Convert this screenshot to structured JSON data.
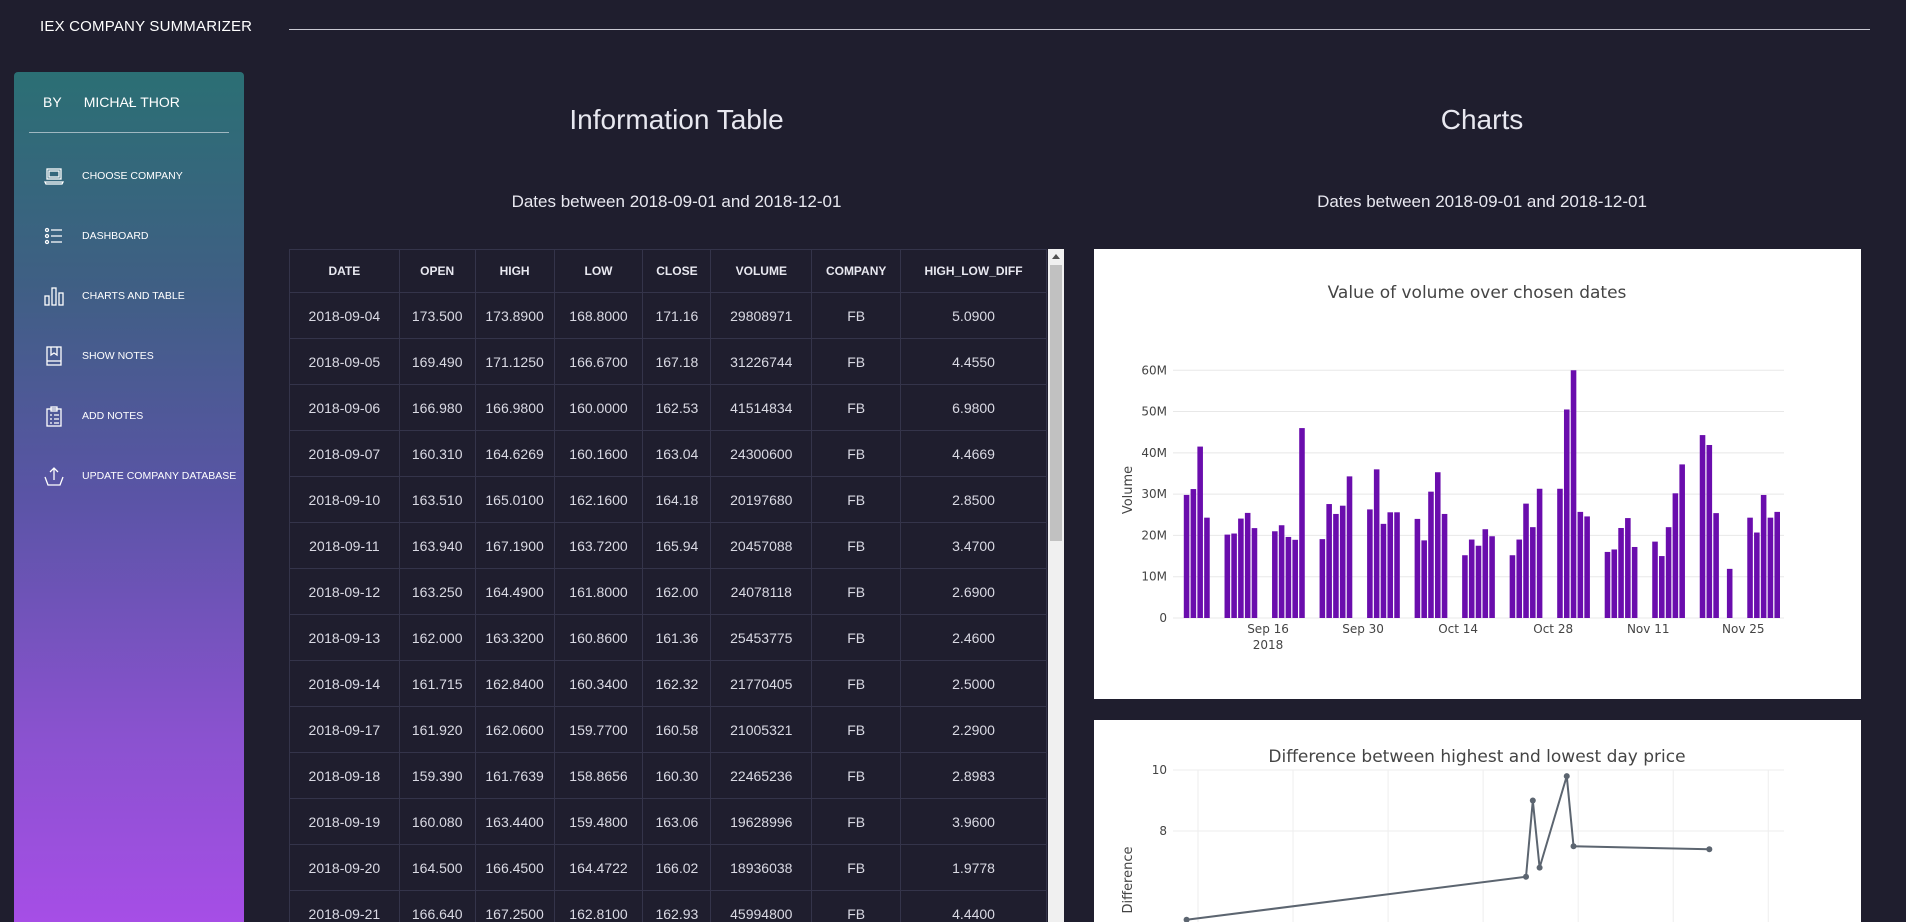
{
  "app": {
    "title": "IEX COMPANY SUMMARIZER"
  },
  "sidebar": {
    "by_label": "BY",
    "author": "MICHAŁ THOR",
    "items": [
      {
        "label": "CHOOSE COMPANY",
        "icon": "laptop-icon"
      },
      {
        "label": "DASHBOARD",
        "icon": "list-icon"
      },
      {
        "label": "CHARTS AND TABLE",
        "icon": "bar-chart-icon"
      },
      {
        "label": "SHOW NOTES",
        "icon": "bookmark-icon"
      },
      {
        "label": "ADD NOTES",
        "icon": "clipboard-icon"
      },
      {
        "label": "UPDATE COMPANY DATABASE",
        "icon": "upload-icon"
      }
    ],
    "colors": {
      "top": "#2b6f74",
      "bottom": "#a64ee6"
    }
  },
  "table_section": {
    "title": "Information Table",
    "subtitle": "Dates between 2018-09-01 and 2018-12-01",
    "columns": [
      "DATE",
      "OPEN",
      "HIGH",
      "LOW",
      "CLOSE",
      "VOLUME",
      "COMPANY",
      "HIGH_LOW_DIFF"
    ],
    "rows": [
      [
        "2018-09-04",
        "173.500",
        "173.8900",
        "168.8000",
        "171.16",
        "29808971",
        "FB",
        "5.0900"
      ],
      [
        "2018-09-05",
        "169.490",
        "171.1250",
        "166.6700",
        "167.18",
        "31226744",
        "FB",
        "4.4550"
      ],
      [
        "2018-09-06",
        "166.980",
        "166.9800",
        "160.0000",
        "162.53",
        "41514834",
        "FB",
        "6.9800"
      ],
      [
        "2018-09-07",
        "160.310",
        "164.6269",
        "160.1600",
        "163.04",
        "24300600",
        "FB",
        "4.4669"
      ],
      [
        "2018-09-10",
        "163.510",
        "165.0100",
        "162.1600",
        "164.18",
        "20197680",
        "FB",
        "2.8500"
      ],
      [
        "2018-09-11",
        "163.940",
        "167.1900",
        "163.7200",
        "165.94",
        "20457088",
        "FB",
        "3.4700"
      ],
      [
        "2018-09-12",
        "163.250",
        "164.4900",
        "161.8000",
        "162.00",
        "24078118",
        "FB",
        "2.6900"
      ],
      [
        "2018-09-13",
        "162.000",
        "163.3200",
        "160.8600",
        "161.36",
        "25453775",
        "FB",
        "2.4600"
      ],
      [
        "2018-09-14",
        "161.715",
        "162.8400",
        "160.3400",
        "162.32",
        "21770405",
        "FB",
        "2.5000"
      ],
      [
        "2018-09-17",
        "161.920",
        "162.0600",
        "159.7700",
        "160.58",
        "21005321",
        "FB",
        "2.2900"
      ],
      [
        "2018-09-18",
        "159.390",
        "161.7639",
        "158.8656",
        "160.30",
        "22465236",
        "FB",
        "2.8983"
      ],
      [
        "2018-09-19",
        "160.080",
        "163.4400",
        "159.4800",
        "163.06",
        "19628996",
        "FB",
        "3.9600"
      ],
      [
        "2018-09-20",
        "164.500",
        "166.4500",
        "164.4722",
        "166.02",
        "18936038",
        "FB",
        "1.9778"
      ],
      [
        "2018-09-21",
        "166.640",
        "167.2500",
        "162.8100",
        "162.93",
        "45994800",
        "FB",
        "4.4400"
      ]
    ]
  },
  "charts_section": {
    "title": "Charts",
    "subtitle": "Dates between 2018-09-01 and 2018-12-01"
  },
  "chart_data": [
    {
      "type": "bar",
      "title": "Value of volume over chosen dates",
      "xlabel": "",
      "ylabel": "Volume",
      "ylim": [
        0,
        62000000
      ],
      "y_ticks": [
        "0",
        "10M",
        "20M",
        "30M",
        "40M",
        "50M",
        "60M"
      ],
      "x_ticks": [
        "Sep 16\n2018",
        "Sep 30",
        "Oct 14",
        "Oct 28",
        "Nov 11",
        "Nov 25"
      ],
      "x_tick_dates": [
        "2018-09-16",
        "2018-09-30",
        "2018-10-14",
        "2018-10-28",
        "2018-11-11",
        "2018-11-25"
      ],
      "bar_color": "#6a0dad",
      "x": [
        "2018-09-04",
        "2018-09-05",
        "2018-09-06",
        "2018-09-07",
        "2018-09-10",
        "2018-09-11",
        "2018-09-12",
        "2018-09-13",
        "2018-09-14",
        "2018-09-17",
        "2018-09-18",
        "2018-09-19",
        "2018-09-20",
        "2018-09-21",
        "2018-09-24",
        "2018-09-25",
        "2018-09-26",
        "2018-09-27",
        "2018-09-28",
        "2018-10-01",
        "2018-10-02",
        "2018-10-03",
        "2018-10-04",
        "2018-10-05",
        "2018-10-08",
        "2018-10-09",
        "2018-10-10",
        "2018-10-11",
        "2018-10-12",
        "2018-10-15",
        "2018-10-16",
        "2018-10-17",
        "2018-10-18",
        "2018-10-19",
        "2018-10-22",
        "2018-10-23",
        "2018-10-24",
        "2018-10-25",
        "2018-10-26",
        "2018-10-29",
        "2018-10-30",
        "2018-10-31",
        "2018-11-01",
        "2018-11-02",
        "2018-11-05",
        "2018-11-06",
        "2018-11-07",
        "2018-11-08",
        "2018-11-09",
        "2018-11-12",
        "2018-11-13",
        "2018-11-14",
        "2018-11-15",
        "2018-11-16",
        "2018-11-19",
        "2018-11-20",
        "2018-11-21",
        "2018-11-23",
        "2018-11-26",
        "2018-11-27",
        "2018-11-28",
        "2018-11-29",
        "2018-11-30"
      ],
      "values": [
        29808971,
        31226744,
        41514834,
        24300600,
        20197680,
        20457088,
        24078118,
        25453775,
        21770405,
        21005321,
        22465236,
        19628996,
        18936038,
        45994800,
        19100000,
        27600000,
        25200000,
        27200000,
        34300000,
        26300000,
        36000000,
        22800000,
        25600000,
        25600000,
        24000000,
        18800000,
        30600000,
        35300000,
        25200000,
        15200000,
        19000000,
        17500000,
        21500000,
        19800000,
        15200000,
        19000000,
        27700000,
        22000000,
        31300000,
        31300000,
        50500000,
        60000000,
        25700000,
        24600000,
        16000000,
        16600000,
        21800000,
        24200000,
        17200000,
        18500000,
        15000000,
        22000000,
        30200000,
        37200000,
        44300000,
        41900000,
        25400000,
        11900000,
        24300000,
        20700000,
        29800000,
        24300000,
        25700000
      ]
    },
    {
      "type": "line",
      "title": "Difference between highest and lowest day price",
      "xlabel": "",
      "ylabel": "Difference",
      "y_ticks": [
        "8",
        "10"
      ],
      "line_color": "#5c6570",
      "partial_visible": true,
      "x": [
        "2018-09-04",
        "2018-10-24",
        "2018-10-25",
        "2018-10-26",
        "2018-10-30",
        "2018-10-31",
        "2018-11-20"
      ],
      "values": [
        5.09,
        6.5,
        9.0,
        6.8,
        9.8,
        7.5,
        7.4
      ]
    }
  ]
}
